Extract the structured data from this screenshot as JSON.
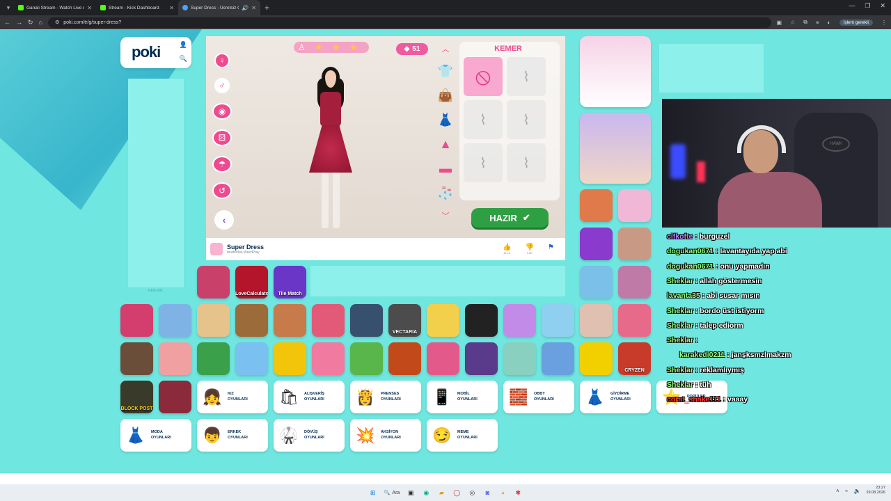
{
  "browser": {
    "tabs": [
      {
        "title": "Ganali Stream - Watch Live on K",
        "color": "#53fc18"
      },
      {
        "title": "Stream - Kick Dashboard",
        "color": "#53fc18"
      },
      {
        "title": "Super Dress - Ücretsiz Onli",
        "color": "#4aa3ff"
      }
    ],
    "url": "poki.com/tr/g/super-dress?",
    "profile_label": "İşlem gerekli"
  },
  "site": {
    "logo": "poki",
    "ad_label": "REKLAM"
  },
  "game": {
    "coins": "51",
    "panel_title": "KEMER",
    "ready_label": "HAZIR",
    "title": "Super Dress",
    "developer": "tarafından WeirdPlay",
    "likes": "11.1K",
    "dislikes": "1.6K"
  },
  "tiles_row1": [
    {
      "label": "",
      "color": "#c9406a"
    },
    {
      "label": "LoveCalculator",
      "color": "#b4152b"
    },
    {
      "label": "Tile Match",
      "color": "#6a36c7"
    }
  ],
  "tiles_row2_colors": [
    "#d43e6e",
    "#7fb3e6",
    "#e7c38c",
    "#9b6b3a",
    "#c77a4a",
    "#e25a78",
    "#36506e",
    "#4c4c4c",
    "#f2d04c",
    "#222",
    "#c28be8",
    "#8fd0f0",
    "#e0c0b0",
    "#e86a8a"
  ],
  "tiles_row2_labels": [
    "",
    "",
    "",
    "",
    "",
    "",
    "",
    "VECTARIA",
    "",
    "",
    "",
    "",
    "",
    ""
  ],
  "tiles_row3_colors": [
    "#6b4e3a",
    "#f0a0a0",
    "#3aa04a",
    "#7ac0f0",
    "#f2c40a",
    "#f07aa0",
    "#59b64a",
    "#c24a1a",
    "#e35a8a",
    "#5a3a8a",
    "#8ad0c0",
    "#6aa0e0",
    "#f2d000",
    "#c83a2a"
  ],
  "tiles_row3_labels": [
    "",
    "",
    "",
    "",
    "",
    "",
    "",
    "",
    "",
    "",
    "",
    "",
    "",
    "CRYZEN"
  ],
  "block_post": "BLOCK POST",
  "categories_row1": [
    {
      "label1": "KIZ",
      "label2": "OYUNLARI",
      "icon": "👧"
    },
    {
      "label1": "ALIŞVERİŞ",
      "label2": "OYUNLARI",
      "icon": "🛍"
    },
    {
      "label1": "PRENSES",
      "label2": "OYUNLARI",
      "icon": "👸"
    },
    {
      "label1": "MOBİL",
      "label2": "OYUNLARI",
      "icon": "📱"
    },
    {
      "label1": "OBBY",
      "label2": "OYUNLARI",
      "icon": "🧱"
    },
    {
      "label1": "GİYDİRME",
      "label2": "OYUNLARI",
      "icon": "👗"
    },
    {
      "label1": "POPÜLER",
      "label2": "",
      "icon": "⭐"
    }
  ],
  "categories_row2": [
    {
      "label1": "MODA",
      "label2": "OYUNLARI",
      "icon": "👗"
    },
    {
      "label1": "ERKEK",
      "label2": "OYUNLARI",
      "icon": "👦"
    },
    {
      "label1": "DÖVÜŞ",
      "label2": "OYUNLARI",
      "icon": "🥋"
    },
    {
      "label1": "AKSİYON",
      "label2": "OYUNLARI",
      "icon": "💥"
    },
    {
      "label1": "MEME",
      "label2": "OYUNLARI",
      "icon": "😏"
    }
  ],
  "chat": [
    {
      "user": "cifkofte",
      "text": "burguzel",
      "color": "purple"
    },
    {
      "user": "dogukan0671",
      "text": "lavantayıda yap abi",
      "color": "green"
    },
    {
      "user": "dogukan0671",
      "text": "onu yapmadın",
      "color": "green"
    },
    {
      "user": "Sheklar",
      "text": "allah göstermesin",
      "color": "green"
    },
    {
      "user": "lavanta35",
      "text": "abi susar mısın",
      "color": "green"
    },
    {
      "user": "Sheklar",
      "text": "bordo üst istiyorm",
      "color": "green"
    },
    {
      "user": "Sheklar",
      "text": "talep ediorm",
      "color": "green"
    },
    {
      "user": "Sheklar",
      "text": "",
      "color": "green"
    },
    {
      "user": "karakedi0211",
      "text": "janşksmzlmakzm",
      "color": "green"
    },
    {
      "user": "Sheklar",
      "text": "reklamlıymış",
      "color": "green"
    },
    {
      "user": "Sheklar",
      "text": "tüh",
      "color": "green"
    },
    {
      "user": "corat_snake111",
      "text": "vaaay",
      "color": "red"
    }
  ],
  "taskbar": {
    "search": "Ara",
    "time": "23:27",
    "date": "29.08.2026"
  }
}
